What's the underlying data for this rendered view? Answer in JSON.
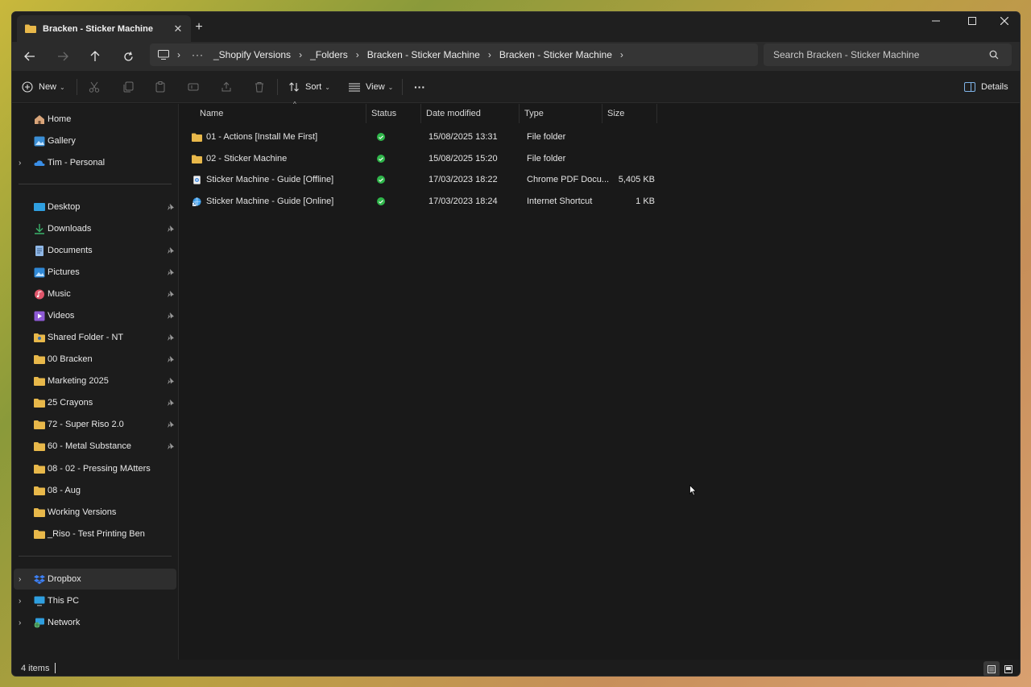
{
  "tab": {
    "title": "Bracken - Sticker Machine",
    "close": "✕",
    "new_tab": "+"
  },
  "window_controls": {
    "minimize": "—",
    "maximize": "☐",
    "close": "✕"
  },
  "address_bar": {
    "more": "···",
    "crumbs": [
      "_Shopify Versions",
      "_Folders",
      "Bracken - Sticker Machine",
      "Bracken - Sticker Machine"
    ]
  },
  "search": {
    "placeholder": "Search Bracken - Sticker Machine"
  },
  "command_bar": {
    "new_label": "New",
    "sort_label": "Sort",
    "view_label": "View",
    "more": "···",
    "details_label": "Details"
  },
  "sidebar": {
    "quick": [
      {
        "label": "Home",
        "icon": "home-icon"
      },
      {
        "label": "Gallery",
        "icon": "gallery-icon"
      },
      {
        "label": "Tim - Personal",
        "icon": "onedrive-icon",
        "expandable": true
      }
    ],
    "pinned": [
      {
        "label": "Desktop",
        "icon": "desktop-icon",
        "pinned": true
      },
      {
        "label": "Downloads",
        "icon": "download-icon",
        "pinned": true
      },
      {
        "label": "Documents",
        "icon": "documents-icon",
        "pinned": true
      },
      {
        "label": "Pictures",
        "icon": "pictures-icon",
        "pinned": true
      },
      {
        "label": "Music",
        "icon": "music-icon",
        "pinned": true
      },
      {
        "label": "Videos",
        "icon": "videos-icon",
        "pinned": true
      },
      {
        "label": "Shared Folder - NT",
        "icon": "shared-folder-icon",
        "pinned": true
      },
      {
        "label": "00 Bracken",
        "icon": "folder-icon",
        "pinned": true
      },
      {
        "label": "Marketing 2025",
        "icon": "folder-icon",
        "pinned": true
      },
      {
        "label": "25 Crayons",
        "icon": "folder-icon",
        "pinned": true
      },
      {
        "label": "72 - Super Riso 2.0",
        "icon": "folder-icon",
        "pinned": true
      },
      {
        "label": "60 - Metal Substance",
        "icon": "folder-icon",
        "pinned": true
      },
      {
        "label": "08 - 02 - Pressing MAtters",
        "icon": "folder-icon",
        "pinned": false
      },
      {
        "label": "08 - Aug",
        "icon": "folder-icon",
        "pinned": false
      },
      {
        "label": "Working Versions",
        "icon": "folder-icon",
        "pinned": false
      },
      {
        "label": "_Riso - Test Printing Ben",
        "icon": "folder-icon",
        "pinned": false
      }
    ],
    "locations": [
      {
        "label": "Dropbox",
        "icon": "dropbox-icon",
        "selected": true
      },
      {
        "label": "This PC",
        "icon": "this-pc-icon",
        "selected": false
      },
      {
        "label": "Network",
        "icon": "network-icon",
        "selected": false
      }
    ]
  },
  "columns": {
    "name": "Name",
    "status": "Status",
    "date": "Date modified",
    "type": "Type",
    "size": "Size"
  },
  "files": [
    {
      "name": "01 - Actions [Install Me First]",
      "icon": "folder-icon",
      "date": "15/08/2025 13:31",
      "type": "File folder",
      "size": ""
    },
    {
      "name": "02 - Sticker Machine",
      "icon": "folder-icon",
      "date": "15/08/2025 15:20",
      "type": "File folder",
      "size": ""
    },
    {
      "name": "Sticker Machine - Guide [Offline]",
      "icon": "pdf-file-icon",
      "date": "17/03/2023 18:22",
      "type": "Chrome PDF Docu...",
      "size": "5,405 KB"
    },
    {
      "name": "Sticker Machine - Guide [Online]",
      "icon": "internet-shortcut-icon",
      "date": "17/03/2023 18:24",
      "type": "Internet Shortcut",
      "size": "1 KB"
    }
  ],
  "status_bar": {
    "item_count": "4 items"
  },
  "colors": {
    "folder": "#e8b84a",
    "status_ok": "#2fb64a",
    "window_bg": "#191919"
  }
}
